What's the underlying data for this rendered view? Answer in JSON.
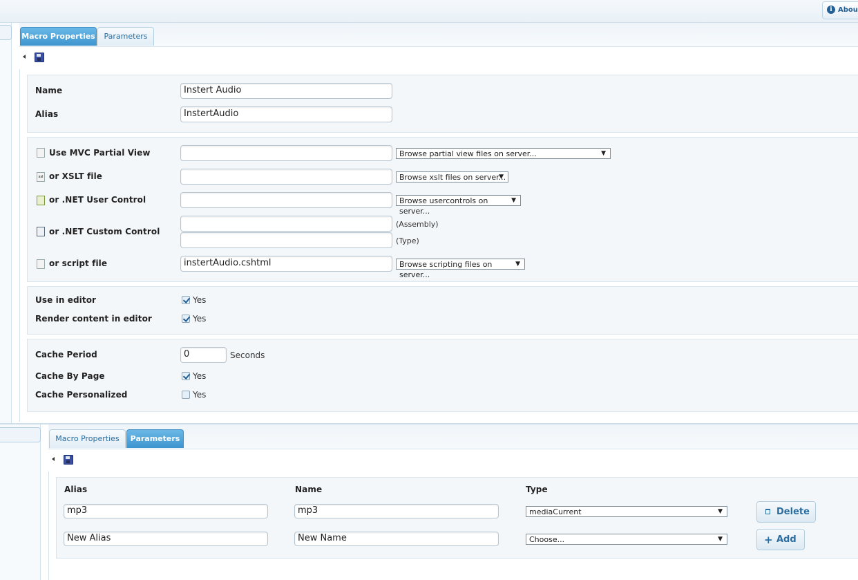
{
  "header": {
    "about_label": "About"
  },
  "top_panel": {
    "tabs": [
      {
        "label": "Macro Properties",
        "active": true
      },
      {
        "label": "Parameters",
        "active": false
      }
    ],
    "name": {
      "label": "Name",
      "value": "Instert Audio"
    },
    "alias": {
      "label": "Alias",
      "value": "InstertAudio"
    },
    "sources": {
      "mvc": {
        "label": "Use MVC Partial View",
        "value": "",
        "browse": "Browse partial view files on server..."
      },
      "xslt": {
        "label": "or XSLT file",
        "value": "",
        "browse": "Browse xslt files on server..."
      },
      "usercontrol": {
        "label": "or .NET User Control",
        "value": "",
        "browse": "Browse usercontrols on server..."
      },
      "custom": {
        "label": "or .NET Custom Control",
        "assembly_value": "",
        "assembly_hint": "(Assembly)",
        "type_value": "",
        "type_hint": "(Type)"
      },
      "script": {
        "label": "or script file",
        "value": "instertAudio.cshtml",
        "browse": "Browse scripting files on server..."
      }
    },
    "editor": {
      "use_in_editor": {
        "label": "Use in editor",
        "checked": true,
        "text": "Yes"
      },
      "render_in_editor": {
        "label": "Render content in editor",
        "checked": true,
        "text": "Yes"
      }
    },
    "cache": {
      "period": {
        "label": "Cache Period",
        "value": "0",
        "unit": "Seconds"
      },
      "by_page": {
        "label": "Cache By Page",
        "checked": true,
        "text": "Yes"
      },
      "personalized": {
        "label": "Cache Personalized",
        "checked": false,
        "text": "Yes"
      }
    }
  },
  "bottom_panel": {
    "tabs": [
      {
        "label": "Macro Properties",
        "active": false
      },
      {
        "label": "Parameters",
        "active": true
      }
    ],
    "columns": {
      "alias": "Alias",
      "name": "Name",
      "type": "Type"
    },
    "rows": [
      {
        "alias": "mp3",
        "name": "mp3",
        "type": "mediaCurrent",
        "action": "Delete"
      },
      {
        "alias": "New Alias",
        "name": "New Name",
        "type": "Choose...",
        "action": "Add"
      }
    ]
  },
  "colors": {
    "accent": "#3e95cf",
    "link": "#2a6da0"
  }
}
